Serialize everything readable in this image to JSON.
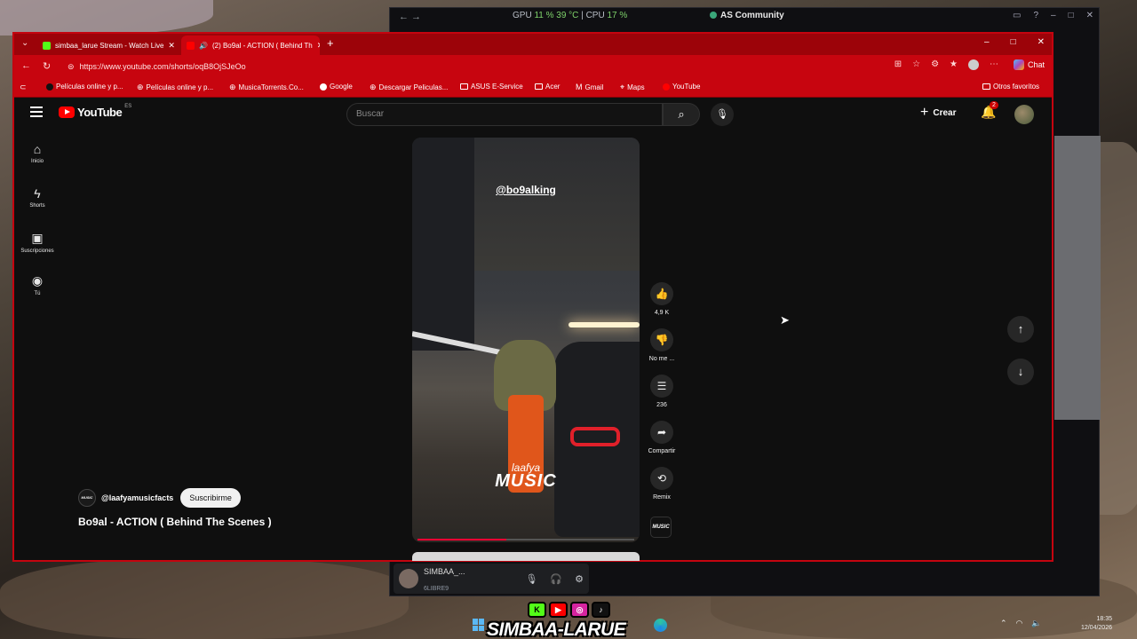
{
  "system": {
    "perf_gpu_label": "GPU",
    "perf_gpu_value": "11 %  39 °C",
    "perf_sep": "|",
    "perf_cpu_label": "CPU",
    "perf_cpu_value": "17 %",
    "back_window_title": "AS Community",
    "discord_user": "SIMBAA_...",
    "discord_status": "6LIBRE9",
    "overlay_text": "SIMBAA-LARUE",
    "clock_time": "18:35",
    "clock_date": "12/04/2026"
  },
  "browser": {
    "tabs": [
      {
        "label": "simbaa_larue Stream - Watch Live",
        "color": "#53fc18"
      },
      {
        "label": "(2) Bo9al - ACTION ( Behind Th",
        "color": "#ff0000"
      }
    ],
    "url": "https://www.youtube.com/shorts/oqB8OjSJeOo",
    "chat_label": "Chat",
    "bookmarks": [
      {
        "label": "Películas online y p..."
      },
      {
        "label": "Películas online y p..."
      },
      {
        "label": "MusicaTorrents.Co..."
      },
      {
        "label": "Google"
      },
      {
        "label": "Descargar Peliculas..."
      },
      {
        "label": "ASUS E-Service"
      },
      {
        "label": "Acer"
      },
      {
        "label": "Gmail"
      },
      {
        "label": "Maps"
      },
      {
        "label": "YouTube"
      }
    ],
    "other_favorites": "Otros favoritos"
  },
  "youtube": {
    "logo_text": "YouTube",
    "logo_country": "ES",
    "search_placeholder": "Buscar",
    "create_label": "Crear",
    "notification_count": "2",
    "sidebar": [
      {
        "label": "Inicio",
        "icon": "home-icon"
      },
      {
        "label": "Shorts",
        "icon": "shorts-icon"
      },
      {
        "label": "Suscripciones",
        "icon": "subscriptions-icon"
      },
      {
        "label": "Tú",
        "icon": "you-icon"
      }
    ],
    "video": {
      "overlay_handle": "@bo9alking",
      "brand_small": "laafya",
      "brand_large": "MUSIC",
      "progress": 0.41
    },
    "actions": {
      "likes": "4,9 K",
      "dislike_label": "No me ...",
      "comments": "236",
      "share_label": "Compartir",
      "remix_label": "Remix"
    },
    "channel": {
      "handle": "@laafyamusicfacts",
      "subscribe_label": "Suscribirme",
      "thumb_text": "MUSIC"
    },
    "video_title": "Bo9al - ACTION ( Behind The Scenes )"
  }
}
